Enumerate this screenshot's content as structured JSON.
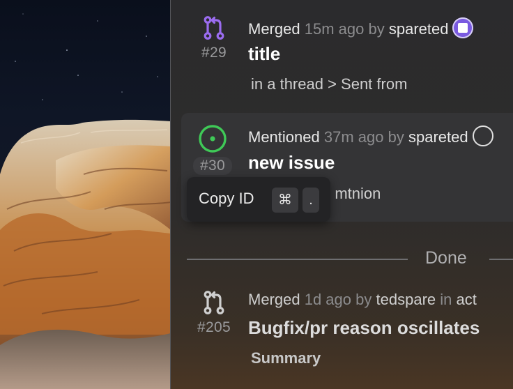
{
  "notifications": [
    {
      "number": "#29",
      "action": "Merged",
      "time": "15m ago",
      "by_word": "by",
      "author": "spareted",
      "title": "title",
      "subtitle": "in a thread > Sent from",
      "icon": "git-pull-request-icon",
      "icon_color": "#9b6cf0"
    },
    {
      "number": "#30",
      "action": "Mentioned",
      "time": "37m ago",
      "by_word": "by",
      "author": "spareted",
      "title": "new issue",
      "subtitle": "e mtnion",
      "icon": "issue-opened-icon",
      "icon_color": "#3fc957"
    },
    {
      "number": "#205",
      "action": "Merged",
      "time": "1d ago",
      "by_word": "by",
      "author": "tedspare",
      "in_word": "in",
      "repo": "act",
      "title": "Bugfix/pr reason oscillates",
      "subtitle": "Summary",
      "icon": "git-pull-request-icon",
      "icon_color": "#cfcfcf"
    }
  ],
  "tooltip": {
    "label": "Copy ID",
    "shortcut_key_1": "⌘",
    "shortcut_key_2": "."
  },
  "section_divider": {
    "label": "Done"
  }
}
